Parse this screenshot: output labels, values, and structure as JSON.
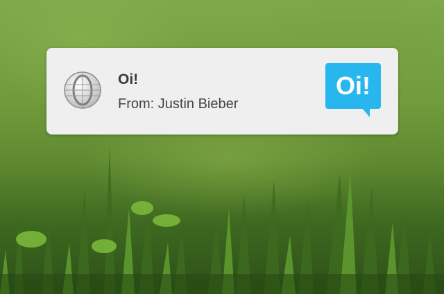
{
  "notification": {
    "title": "Oi!",
    "message": "From: Justin Bieber",
    "app_icon": "opera-icon",
    "content_image": {
      "text": "Oi!",
      "icon": "speech-bubble-icon",
      "color": "#27b7ee"
    }
  },
  "colors": {
    "notification_bg": "#efefef",
    "title": "#3a3a3a",
    "message": "#444444",
    "accent": "#27b7ee"
  }
}
